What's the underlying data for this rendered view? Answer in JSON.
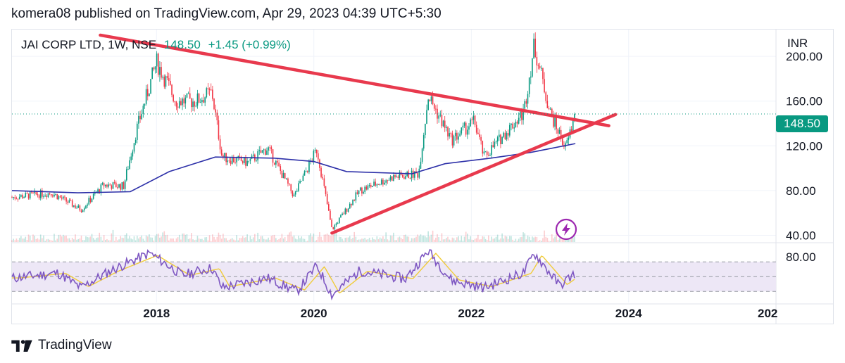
{
  "header": {
    "publish_line": "komera08 published on TradingView.com, Apr 29, 2023 04:39 UTC+5:30"
  },
  "legend": {
    "symbol": "JAI CORP LTD, 1W, NSE",
    "last": "148.50",
    "change": "+1.45 (+0.99%)"
  },
  "axis": {
    "currency": "INR",
    "last_price_tag": "148.50"
  },
  "footer": {
    "brand": "TradingView"
  },
  "colors": {
    "up": "#089981",
    "down": "#f23645",
    "ma": "#2c2fa8",
    "trendline": "#e8394d",
    "rsi": "#7e57c2",
    "rsi_ma": "#f0cc3a",
    "rsi_band": "#ede7f6",
    "icon": "#9c27b0"
  },
  "icons": {
    "flash": "lightning-icon",
    "brand_logo": "tradingview-logo-icon"
  },
  "chart_data": [
    {
      "type": "candlestick",
      "title": "JAI CORP LTD, 1W, NSE",
      "xlabel": "",
      "ylabel": "INR",
      "x_ticks": [
        "2018",
        "2020",
        "2022",
        "2024",
        "202"
      ],
      "y_ticks": [
        "40.00",
        "80.00",
        "120.00",
        "160.00",
        "200.00"
      ],
      "ylim": [
        34,
        224
      ],
      "xlim": [
        "2016-03-01",
        "2025-11-15"
      ],
      "grid": true,
      "last_close": 148.5,
      "close_approx_path": [
        {
          "x": "2016-03-01",
          "y": 74
        },
        {
          "x": "2016-09-01",
          "y": 78
        },
        {
          "x": "2017-01-15",
          "y": 63
        },
        {
          "x": "2017-05-01",
          "y": 85
        },
        {
          "x": "2017-08-01",
          "y": 84
        },
        {
          "x": "2017-10-01",
          "y": 135
        },
        {
          "x": "2018-01-01",
          "y": 195
        },
        {
          "x": "2018-04-01",
          "y": 160
        },
        {
          "x": "2018-07-01",
          "y": 160
        },
        {
          "x": "2018-09-15",
          "y": 168
        },
        {
          "x": "2018-11-01",
          "y": 110
        },
        {
          "x": "2019-03-01",
          "y": 105
        },
        {
          "x": "2019-06-01",
          "y": 118
        },
        {
          "x": "2019-10-01",
          "y": 75
        },
        {
          "x": "2020-01-15",
          "y": 117
        },
        {
          "x": "2020-03-25",
          "y": 45
        },
        {
          "x": "2020-08-01",
          "y": 80
        },
        {
          "x": "2021-01-01",
          "y": 92
        },
        {
          "x": "2021-05-01",
          "y": 95
        },
        {
          "x": "2021-06-15",
          "y": 165
        },
        {
          "x": "2021-10-01",
          "y": 125
        },
        {
          "x": "2022-01-15",
          "y": 142
        },
        {
          "x": "2022-03-01",
          "y": 110
        },
        {
          "x": "2022-06-01",
          "y": 130
        },
        {
          "x": "2022-09-01",
          "y": 150
        },
        {
          "x": "2022-10-20",
          "y": 210
        },
        {
          "x": "2023-01-01",
          "y": 150
        },
        {
          "x": "2023-03-15",
          "y": 118
        },
        {
          "x": "2023-04-29",
          "y": 148.5
        }
      ],
      "moving_average_path": [
        {
          "x": "2016-03-01",
          "y": 80
        },
        {
          "x": "2017-01-01",
          "y": 78
        },
        {
          "x": "2017-09-01",
          "y": 79
        },
        {
          "x": "2018-03-01",
          "y": 97
        },
        {
          "x": "2018-10-01",
          "y": 110
        },
        {
          "x": "2019-07-01",
          "y": 109
        },
        {
          "x": "2020-01-01",
          "y": 106
        },
        {
          "x": "2020-06-01",
          "y": 97
        },
        {
          "x": "2021-04-01",
          "y": 95
        },
        {
          "x": "2021-09-01",
          "y": 104
        },
        {
          "x": "2022-04-01",
          "y": 109
        },
        {
          "x": "2022-10-01",
          "y": 114
        },
        {
          "x": "2023-04-29",
          "y": 122
        }
      ],
      "trendlines": [
        {
          "from": {
            "x": "2017-04-15",
            "y": 219
          },
          "to": {
            "x": "2023-10-01",
            "y": 138
          }
        },
        {
          "from": {
            "x": "2020-03-25",
            "y": 42
          },
          "to": {
            "x": "2023-11-01",
            "y": 148
          }
        }
      ]
    },
    {
      "type": "line",
      "title": "",
      "y_ticks": [
        "80.00"
      ],
      "ylim": [
        15,
        95
      ],
      "bands": [
        30,
        50,
        70
      ],
      "rsi_approx_path": [
        {
          "x": "2016-03-01",
          "y": 48
        },
        {
          "x": "2016-10-01",
          "y": 55
        },
        {
          "x": "2017-01-15",
          "y": 35
        },
        {
          "x": "2017-06-01",
          "y": 58
        },
        {
          "x": "2017-12-01",
          "y": 82
        },
        {
          "x": "2018-05-01",
          "y": 52
        },
        {
          "x": "2018-09-15",
          "y": 62
        },
        {
          "x": "2018-11-01",
          "y": 35
        },
        {
          "x": "2019-06-01",
          "y": 48
        },
        {
          "x": "2019-10-15",
          "y": 30
        },
        {
          "x": "2020-01-15",
          "y": 65
        },
        {
          "x": "2020-03-25",
          "y": 25
        },
        {
          "x": "2020-08-01",
          "y": 58
        },
        {
          "x": "2021-03-01",
          "y": 47
        },
        {
          "x": "2021-06-15",
          "y": 85
        },
        {
          "x": "2021-10-01",
          "y": 45
        },
        {
          "x": "2022-03-01",
          "y": 35
        },
        {
          "x": "2022-09-01",
          "y": 55
        },
        {
          "x": "2022-10-20",
          "y": 82
        },
        {
          "x": "2023-02-15",
          "y": 38
        },
        {
          "x": "2023-04-29",
          "y": 55
        }
      ]
    }
  ]
}
